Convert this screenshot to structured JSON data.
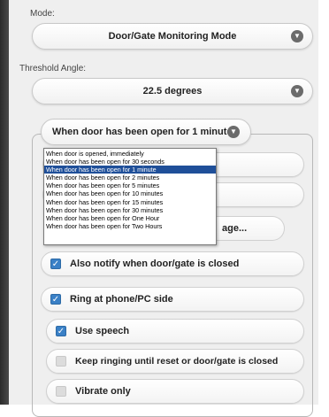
{
  "mode": {
    "label": "Mode:",
    "value": "Door/Gate Monitoring Mode",
    "icon": "chevron-down-icon"
  },
  "threshold": {
    "label": "Threshold Angle:",
    "value": "22.5 degrees",
    "icon": "chevron-down-icon"
  },
  "duration_select": {
    "value": "When door has been open for 1 minute",
    "options": [
      "When door is opened, immediately",
      "When door has been open for 30 seconds",
      "When door has been open for 1 minute",
      "When door has been open for 2 minutes",
      "When door has been open for 5 minutes",
      "When door has been open for 10 minutes",
      "When door has been open for 15 minutes",
      "When door has been open for 30 minutes",
      "When door has been open for One Hour",
      "When door has been open for Two Hours"
    ],
    "selected_index": 2
  },
  "partial_button_text": "age...",
  "options": {
    "notify_closed": {
      "label": "Also notify when door/gate is closed",
      "checked": true
    },
    "ring_phone": {
      "label": "Ring at phone/PC side",
      "checked": true
    },
    "use_speech": {
      "label": "Use speech",
      "checked": true
    },
    "keep_ringing": {
      "label": "Keep ringing until reset or door/gate is closed",
      "checked": false
    },
    "vibrate_only": {
      "label": "Vibrate only",
      "checked": false
    }
  },
  "colors": {
    "accent": "#3a80c6",
    "selected": "#1f4f99",
    "panel": "#efefef"
  }
}
